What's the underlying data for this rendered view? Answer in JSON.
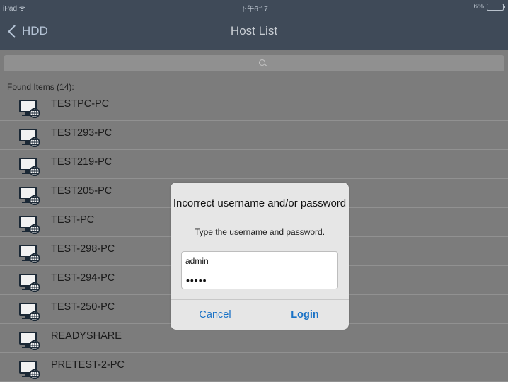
{
  "status_bar": {
    "device": "iPad",
    "time": "下午6:17",
    "battery": "6%"
  },
  "nav": {
    "back_label": "HDD",
    "title": "Host List"
  },
  "search": {
    "placeholder": ""
  },
  "list": {
    "section_header": "Found Items (14):",
    "items": [
      "TESTPC-PC",
      "TEST293-PC",
      "TEST219-PC",
      "TEST205-PC",
      "TEST-PC",
      "TEST-298-PC",
      "TEST-294-PC",
      "TEST-250-PC",
      "READYSHARE",
      "PRETEST-2-PC"
    ]
  },
  "dialog": {
    "title": "Incorrect username and/or password",
    "subtitle": "Type the username and password.",
    "username_value": "admin",
    "password_mask": "•••••",
    "cancel_label": "Cancel",
    "login_label": "Login"
  },
  "icons": {
    "computer": "pc-network-icon",
    "search": "search-icon",
    "back": "chevron-left-icon",
    "wifi": "wifi-icon",
    "battery": "battery-icon"
  },
  "colors": {
    "nav_bg": "#3f4a58",
    "list_bg": "#7c7c7c",
    "dialog_bg": "#e6e6e6",
    "accent": "#1a72c6"
  }
}
